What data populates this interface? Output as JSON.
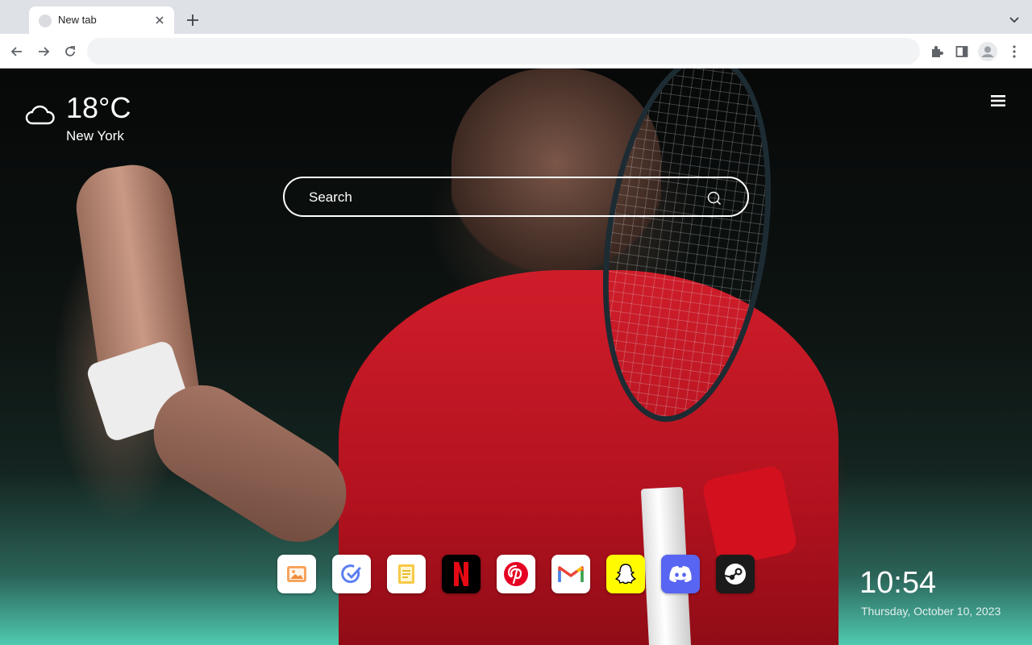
{
  "browser": {
    "tab": {
      "title": "New tab"
    },
    "omnibox": {
      "value": "",
      "placeholder": ""
    }
  },
  "weather": {
    "temperature": "18°C",
    "city": "New York",
    "icon": "cloud-icon"
  },
  "search": {
    "placeholder": "Search"
  },
  "apps": [
    {
      "name": "Gallery",
      "icon": "image-icon",
      "bg": "#ffffff"
    },
    {
      "name": "Tasks",
      "icon": "check-icon",
      "bg": "#ffffff"
    },
    {
      "name": "Notes",
      "icon": "note-icon",
      "bg": "#ffffff"
    },
    {
      "name": "Netflix",
      "icon": "netflix-icon",
      "bg": "#000000"
    },
    {
      "name": "Pinterest",
      "icon": "pinterest-icon",
      "bg": "#ffffff"
    },
    {
      "name": "Gmail",
      "icon": "gmail-icon",
      "bg": "#ffffff"
    },
    {
      "name": "Snapchat",
      "icon": "snapchat-icon",
      "bg": "#fffc00"
    },
    {
      "name": "Discord",
      "icon": "discord-icon",
      "bg": "#5865f2"
    },
    {
      "name": "Steam",
      "icon": "steam-icon",
      "bg": "#1b1b1b"
    }
  ],
  "clock": {
    "time": "10:54",
    "date": "Thursday, October 10, 2023"
  },
  "colors": {
    "netflix_red": "#e50914",
    "pinterest_red": "#e60023",
    "snapchat_yellow": "#fffc00",
    "discord_blurple": "#5865f2"
  }
}
